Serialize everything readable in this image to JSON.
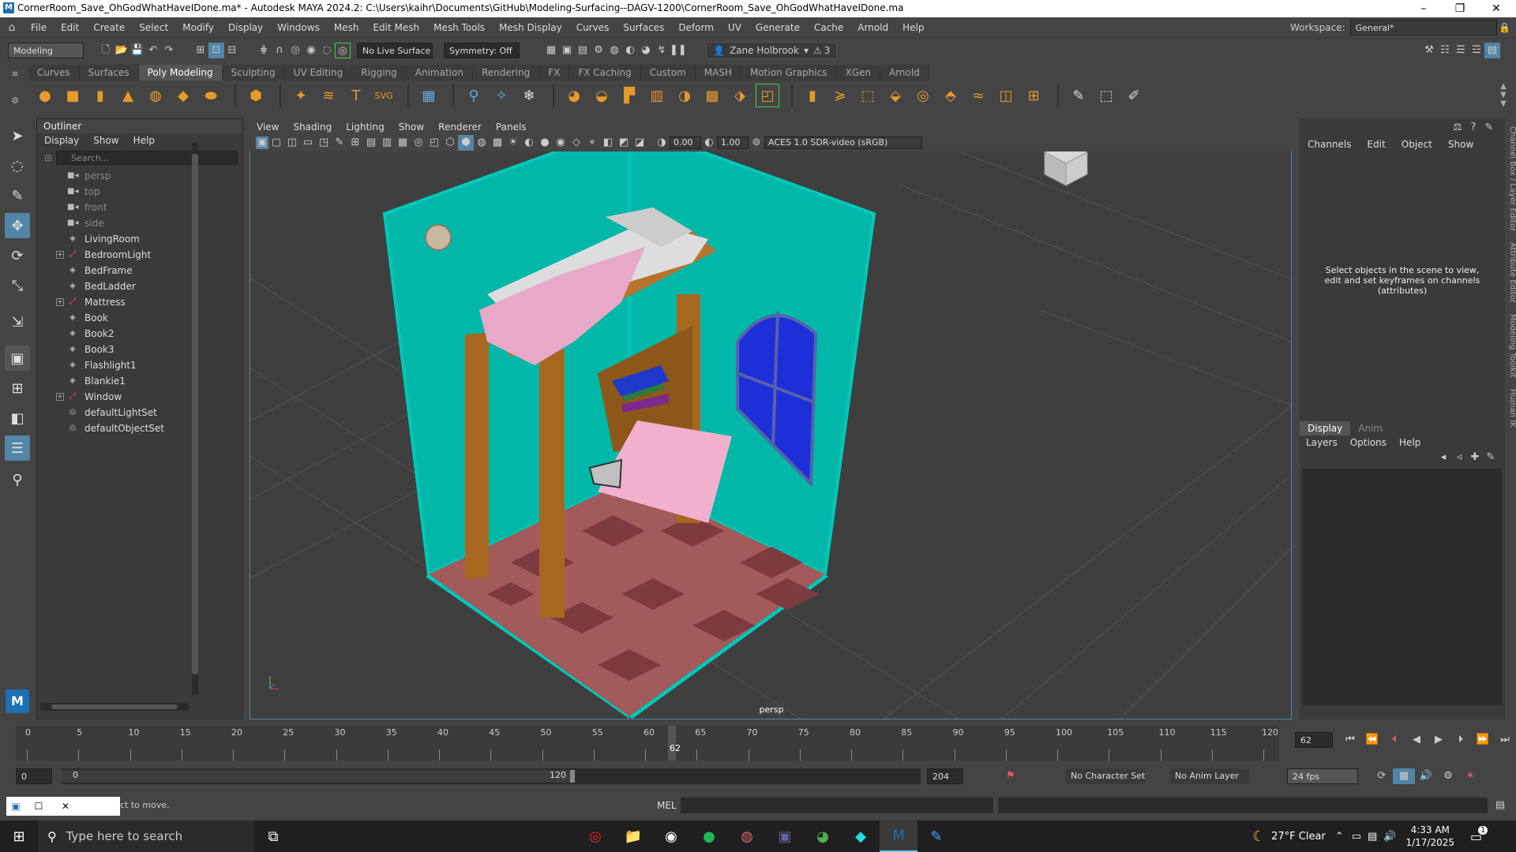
{
  "title_bar": {
    "title": "CornerRoom_Save_OhGodWhatHaveIDone.ma* - Autodesk MAYA 2024.2: C:\\Users\\kaihr\\Documents\\GitHub\\Modeling-Surfacing--DAGV-1200\\CornerRoom_Save_OhGodWhatHaveIDone.ma",
    "minimize": "–",
    "maximize": "❐",
    "close": "✕"
  },
  "menu": [
    "File",
    "Edit",
    "Create",
    "Select",
    "Modify",
    "Display",
    "Windows",
    "Mesh",
    "Edit Mesh",
    "Mesh Tools",
    "Mesh Display",
    "Curves",
    "Surfaces",
    "Deform",
    "UV",
    "Generate",
    "Cache",
    "Arnold",
    "Help"
  ],
  "workspace": {
    "label": "Workspace:",
    "value": "General*"
  },
  "status": {
    "mode": "Modeling",
    "live_surface": "No Live Surface",
    "symmetry": "Symmetry: Off",
    "user": "Zane Holbrook",
    "warnings": "3"
  },
  "shelf_tabs": [
    "Curves",
    "Surfaces",
    "Poly Modeling",
    "Sculpting",
    "UV Editing",
    "Rigging",
    "Animation",
    "Rendering",
    "FX",
    "FX Caching",
    "Custom",
    "MASH",
    "Motion Graphics",
    "XGen",
    "Arnold"
  ],
  "shelf_active": "Poly Modeling",
  "outliner": {
    "title": "Outliner",
    "menu": [
      "Display",
      "Show",
      "Help"
    ],
    "search_placeholder": "Search...",
    "items": [
      {
        "label": "persp",
        "icon": "camera-icon",
        "dim": true,
        "expand": false
      },
      {
        "label": "top",
        "icon": "camera-icon",
        "dim": true,
        "expand": false
      },
      {
        "label": "front",
        "icon": "camera-icon",
        "dim": true,
        "expand": false
      },
      {
        "label": "side",
        "icon": "camera-icon",
        "dim": true,
        "expand": false
      },
      {
        "label": "LivingRoom",
        "icon": "mesh-icon",
        "dim": false,
        "expand": false
      },
      {
        "label": "BedroomLight",
        "icon": "group-icon",
        "dim": false,
        "expand": true
      },
      {
        "label": "BedFrame",
        "icon": "mesh-icon",
        "dim": false,
        "expand": false
      },
      {
        "label": "BedLadder",
        "icon": "mesh-icon",
        "dim": false,
        "expand": false
      },
      {
        "label": "Mattress",
        "icon": "group-icon",
        "dim": false,
        "expand": true
      },
      {
        "label": "Book",
        "icon": "mesh-icon",
        "dim": false,
        "expand": false
      },
      {
        "label": "Book2",
        "icon": "mesh-icon",
        "dim": false,
        "expand": false
      },
      {
        "label": "Book3",
        "icon": "mesh-icon",
        "dim": false,
        "expand": false
      },
      {
        "label": "Flashlight1",
        "icon": "mesh-icon",
        "dim": false,
        "expand": false
      },
      {
        "label": "Blankie1",
        "icon": "mesh-icon",
        "dim": false,
        "expand": false
      },
      {
        "label": "Window",
        "icon": "group-icon",
        "dim": false,
        "expand": true
      },
      {
        "label": "defaultLightSet",
        "icon": "set-icon",
        "dim": false,
        "expand": false
      },
      {
        "label": "defaultObjectSet",
        "icon": "set-icon",
        "dim": false,
        "expand": false
      }
    ]
  },
  "viewport": {
    "menu": [
      "View",
      "Shading",
      "Lighting",
      "Show",
      "Renderer",
      "Panels"
    ],
    "exposure": "0.00",
    "gamma": "1.00",
    "colorspace": "ACES 1.0 SDR-video (sRGB)",
    "camera_label": "persp"
  },
  "channel_box": {
    "menu": [
      "Channels",
      "Edit",
      "Object",
      "Show"
    ],
    "hint": "Select objects in the scene to view, edit and set keyframes on channels (attributes)"
  },
  "layer_editor": {
    "tabs": [
      "Display",
      "Anim"
    ],
    "menu": [
      "Layers",
      "Options",
      "Help"
    ]
  },
  "side_tabs": [
    "Channel Box / Layer Editor",
    "Attribute Editor",
    "Modeling Toolkit",
    "Human IK"
  ],
  "timeline": {
    "ticks": [
      "0",
      "5",
      "10",
      "15",
      "20",
      "25",
      "30",
      "35",
      "40",
      "45",
      "50",
      "55",
      "60",
      "65",
      "70",
      "75",
      "80",
      "85",
      "90",
      "95",
      "100",
      "105",
      "110",
      "115",
      "120"
    ],
    "current_frame": "62",
    "current_frame_field": "62"
  },
  "range": {
    "start": "0",
    "inner_start": "0",
    "inner_end": "120",
    "end": "204",
    "character_set": "No Character Set",
    "anim_layer": "No Anim Layer",
    "fps": "24 fps"
  },
  "cmd": {
    "help_line": "ct to move.",
    "mel_label": "MEL"
  },
  "taskbar": {
    "search_placeholder": "Type here to search",
    "weather": "27°F  Clear",
    "time": "4:33 AM",
    "date": "1/17/2025",
    "notifications": "1"
  },
  "colors": {
    "wall": "#00b7a8",
    "floor": "#a35a5a",
    "wood": "#a8671f",
    "blanket": "#e8a8c8",
    "window": "#1d2fd8",
    "selection": "#5285a6"
  }
}
